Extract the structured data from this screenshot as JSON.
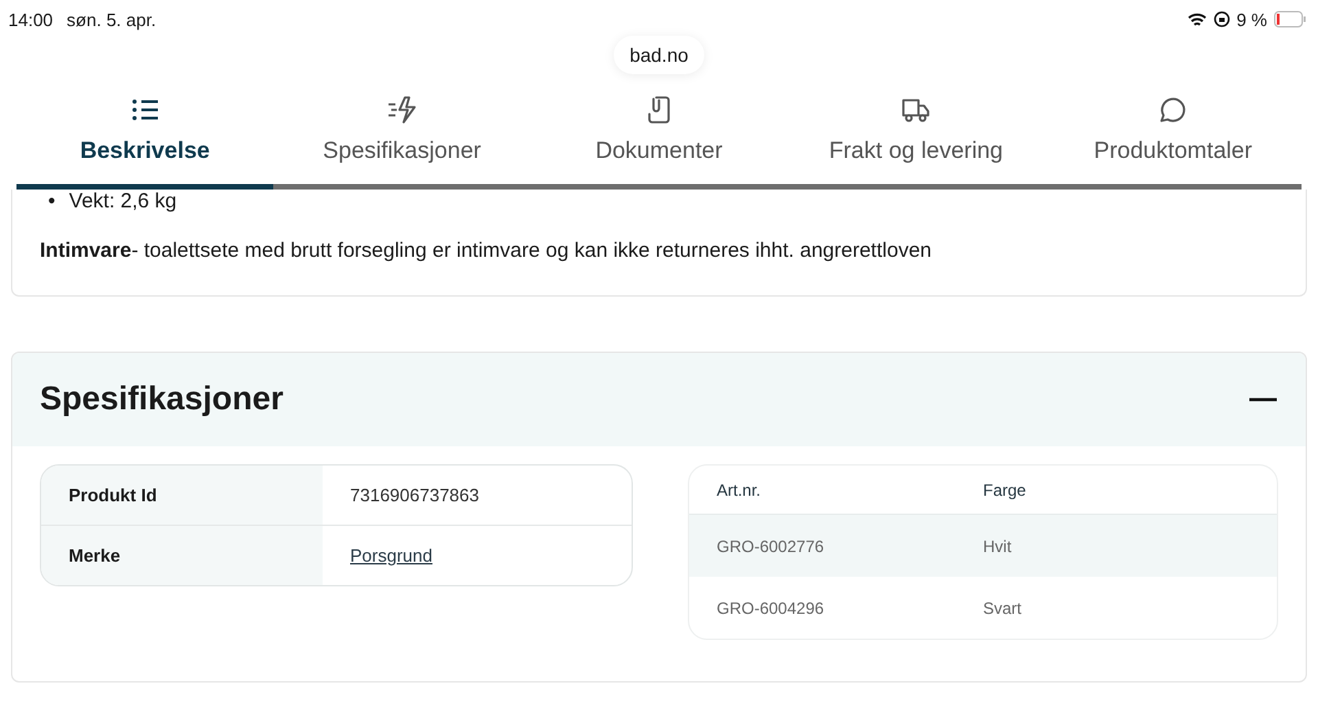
{
  "status_bar": {
    "time": "14:00",
    "date": "søn. 5. apr.",
    "battery": "9 %"
  },
  "address_bar": {
    "url": "bad.no"
  },
  "tabs": [
    {
      "label": "Beskrivelse",
      "kind": "list",
      "selected": true
    },
    {
      "label": "Spesifikasjoner",
      "kind": "bolt",
      "selected": false
    },
    {
      "label": "Dokumenter",
      "kind": "clip",
      "selected": false
    },
    {
      "label": "Frakt og levering",
      "kind": "truck",
      "selected": false
    },
    {
      "label": "Produktomtaler",
      "kind": "chat",
      "selected": false
    }
  ],
  "description": {
    "bullets": [
      {
        "marker": "•",
        "text": "Vekt: 2,6 kg"
      }
    ],
    "note": "**Intimvare**- toalettsete med brutt forsegling er intimvare og kan ikke returneres ihht. angrerettloven"
  },
  "specifications": {
    "title": "Spesifikasjoner",
    "expanded": true,
    "properties": [
      {
        "label": "Produkt Id",
        "value": "7316906737863",
        "kind": "text"
      },
      {
        "label": "Merke",
        "value": "Porsgrund",
        "kind": "link"
      }
    ],
    "variants": {
      "columns": [
        "Art.nr.",
        "Farge"
      ],
      "rows": [
        [
          "GRO-6002776",
          "Hvit"
        ],
        [
          "GRO-6004296",
          "Svart"
        ]
      ]
    }
  }
}
